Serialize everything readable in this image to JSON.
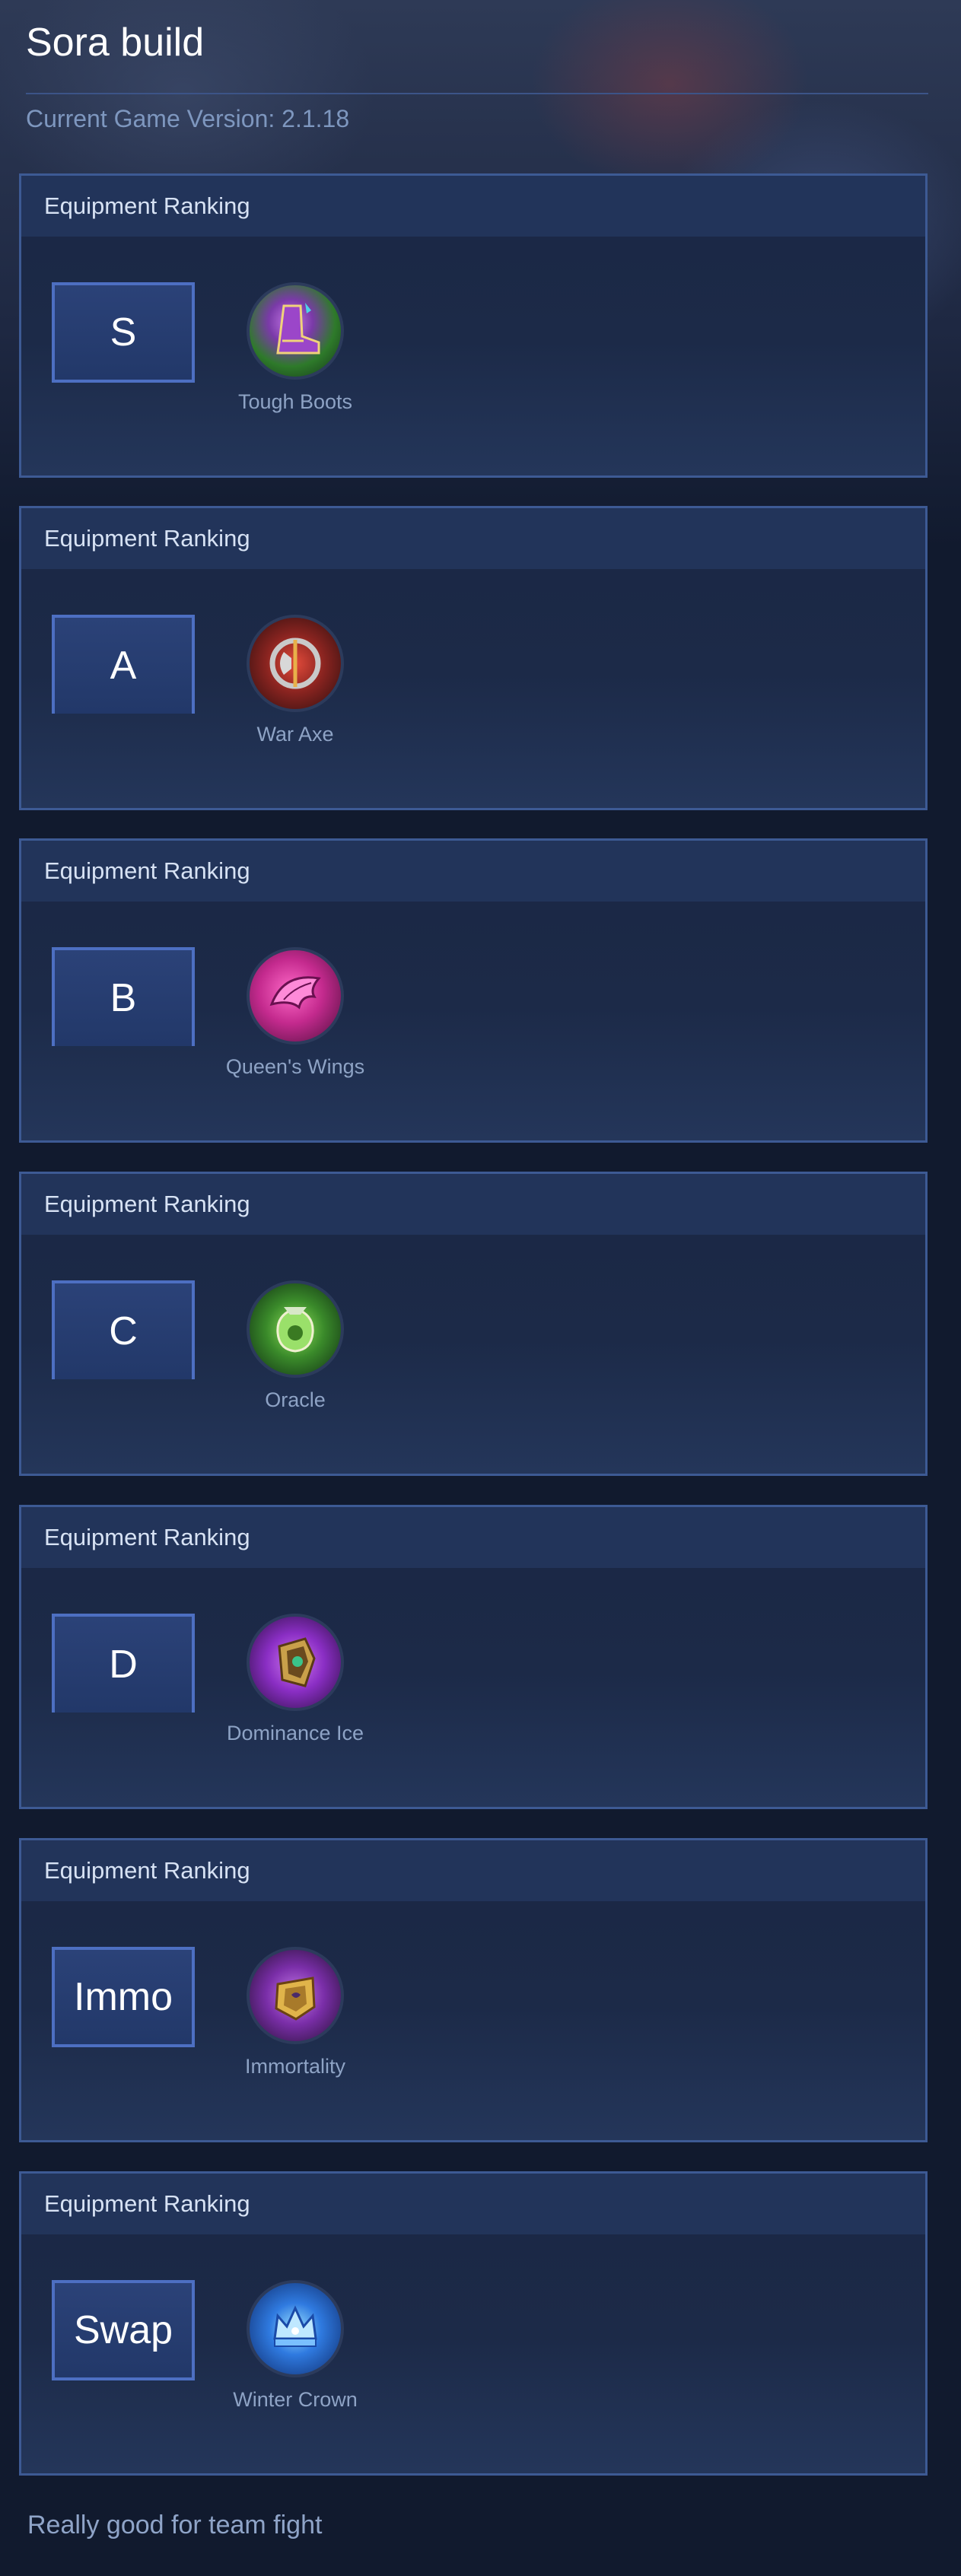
{
  "page": {
    "title": "Sora build",
    "version": "Current Game Version: 2.1.18",
    "footer_note": "Really good for team fight"
  },
  "rankings": [
    {
      "header": "Equipment Ranking",
      "tier": "S",
      "item": {
        "name": "Tough Boots",
        "icon": "tough-boots-icon",
        "color": "#3fa53a"
      }
    },
    {
      "header": "Equipment Ranking",
      "tier": "A",
      "item": {
        "name": "War Axe",
        "icon": "war-axe-icon",
        "color": "#b43a2e"
      }
    },
    {
      "header": "Equipment Ranking",
      "tier": "B",
      "item": {
        "name": "Queen's Wings",
        "icon": "queens-wings-icon",
        "color": "#e03aa0"
      }
    },
    {
      "header": "Equipment Ranking",
      "tier": "C",
      "item": {
        "name": "Oracle",
        "icon": "oracle-icon",
        "color": "#5fbf3a"
      }
    },
    {
      "header": "Equipment Ranking",
      "tier": "D",
      "item": {
        "name": "Dominance Ice",
        "icon": "dominance-ice-icon",
        "color": "#9a3ad0"
      }
    },
    {
      "header": "Equipment Ranking",
      "tier": "Immo",
      "item": {
        "name": "Immortality",
        "icon": "immortality-icon",
        "color": "#8e3ac4"
      }
    },
    {
      "header": "Equipment Ranking",
      "tier": "Swap",
      "item": {
        "name": "Winter Crown",
        "icon": "winter-crown-icon",
        "color": "#2f8ff0"
      }
    }
  ]
}
